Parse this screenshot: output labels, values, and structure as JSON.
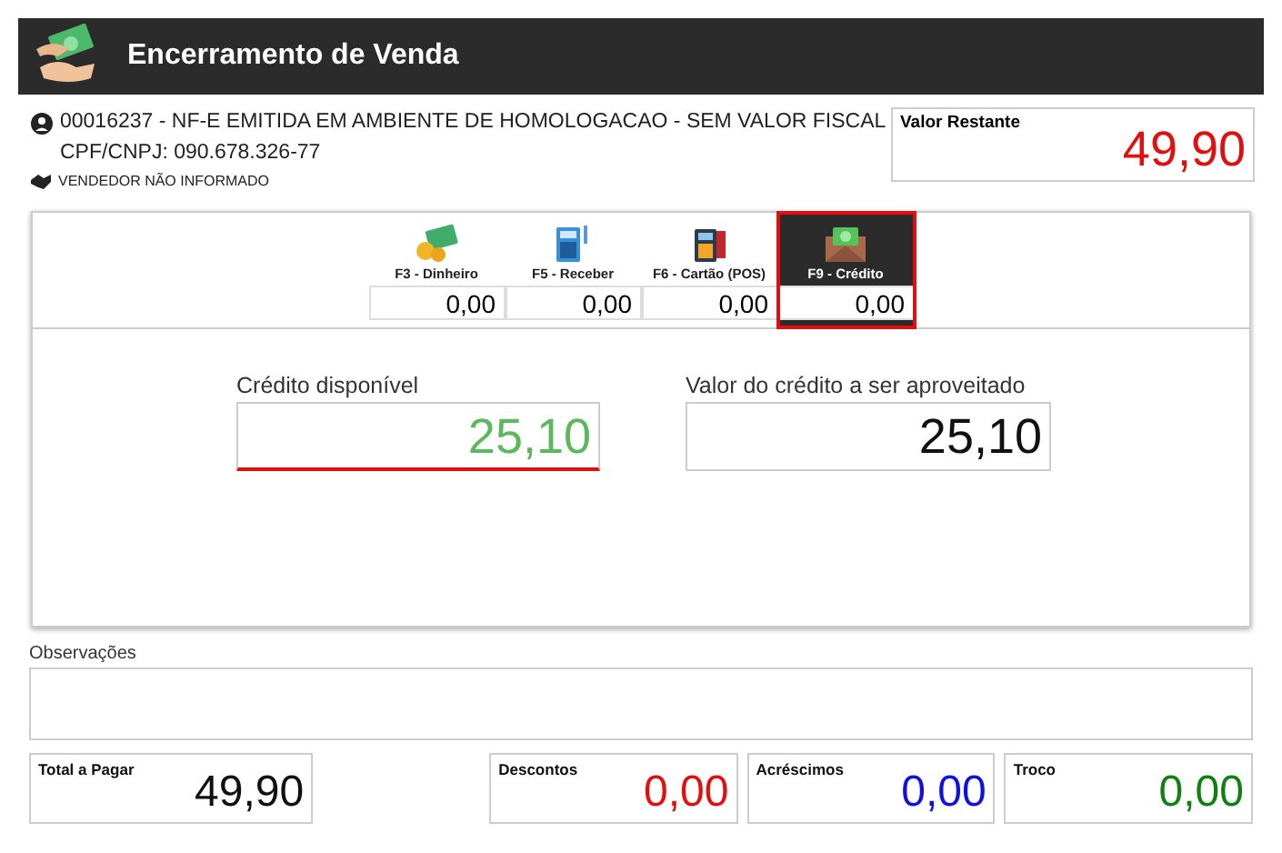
{
  "window": {
    "title": "Encerramento de Venda"
  },
  "sale": {
    "line1": "00016237 - NF-E EMITIDA EM AMBIENTE DE HOMOLOGACAO - SEM VALOR FISCAL",
    "line2": "CPF/CNPJ: 090.678.326-77",
    "seller": "VENDEDOR NÃO INFORMADO"
  },
  "remaining": {
    "label": "Valor Restante",
    "value": "49,90"
  },
  "payment_methods": [
    {
      "kind": "cash",
      "label": "F3 - Dinheiro",
      "value": "0,00",
      "selected": false
    },
    {
      "kind": "receivable",
      "label": "F5 - Receber",
      "value": "0,00",
      "selected": false
    },
    {
      "kind": "card",
      "label": "F6 - Cartão (POS)",
      "value": "0,00",
      "selected": false
    },
    {
      "kind": "credit",
      "label": "F9 - Crédito",
      "value": "0,00",
      "selected": true
    }
  ],
  "credit": {
    "available_label": "Crédito disponível",
    "available": "25,10",
    "use_label": "Valor do crédito a ser aproveitado",
    "use": "25,10"
  },
  "notes": {
    "label": "Observações"
  },
  "totals": [
    {
      "label": "Total a Pagar",
      "value": "49,90",
      "color": "#111111"
    },
    {
      "label": "Descontos",
      "value": "0,00",
      "color": "#e01010"
    },
    {
      "label": "Acréscimos",
      "value": "0,00",
      "color": "#1010e0"
    },
    {
      "label": "Troco",
      "value": "0,00",
      "color": "#108010"
    }
  ]
}
